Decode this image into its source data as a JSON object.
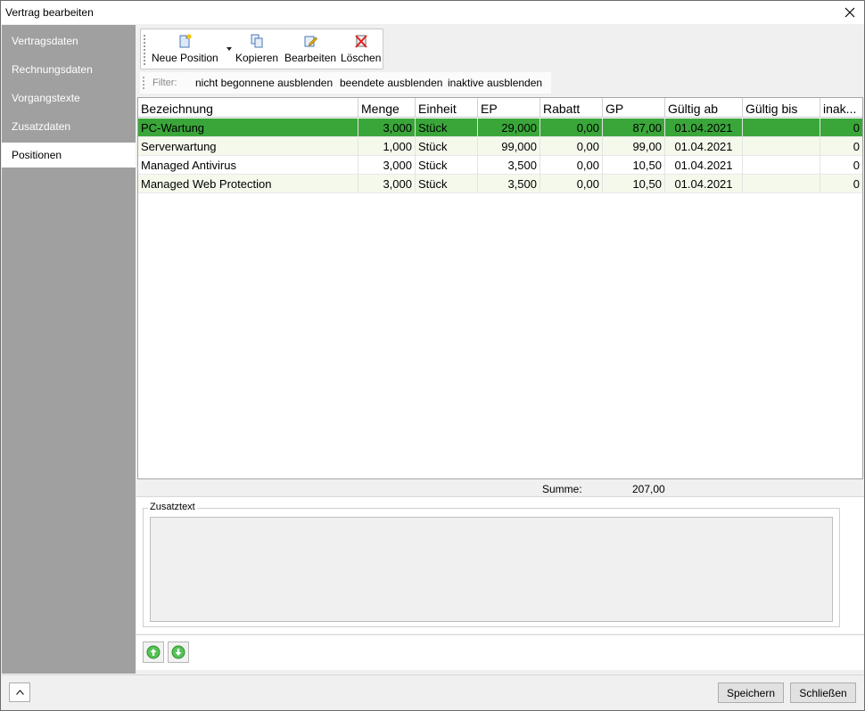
{
  "window": {
    "title": "Vertrag bearbeiten"
  },
  "sidebar": {
    "items": [
      {
        "label": "Vertragsdaten"
      },
      {
        "label": "Rechnungsdaten"
      },
      {
        "label": "Vorgangstexte"
      },
      {
        "label": "Zusatzdaten"
      },
      {
        "label": "Positionen",
        "active": true
      }
    ]
  },
  "toolbar": {
    "neue_position": "Neue Position",
    "kopieren": "Kopieren",
    "bearbeiten": "Bearbeiten",
    "loeschen": "Löschen"
  },
  "filter": {
    "label": "Filter:",
    "options": [
      "nicht begonnene ausblenden",
      "beendete ausblenden",
      "inaktive  ausblenden"
    ]
  },
  "grid": {
    "columns": [
      "Bezeichnung",
      "Menge",
      "Einheit",
      "EP",
      "Rabatt",
      "GP",
      "Gültig ab",
      "Gültig bis",
      "inak..."
    ],
    "rows": [
      [
        "PC-Wartung",
        "3,000",
        "Stück",
        "29,000",
        "0,00",
        "87,00",
        "01.04.2021",
        "",
        "0"
      ],
      [
        "Serverwartung",
        "1,000",
        "Stück",
        "99,000",
        "0,00",
        "99,00",
        "01.04.2021",
        "",
        "0"
      ],
      [
        "Managed Antivirus",
        "3,000",
        "Stück",
        "3,500",
        "0,00",
        "10,50",
        "01.04.2021",
        "",
        "0"
      ],
      [
        "Managed Web Protection",
        "3,000",
        "Stück",
        "3,500",
        "0,00",
        "10,50",
        "01.04.2021",
        "",
        "0"
      ]
    ],
    "selected_row": 0
  },
  "summary": {
    "label": "Summe:",
    "value": "207,00"
  },
  "zusatztext": {
    "legend": "Zusatztext",
    "value": ""
  },
  "footer": {
    "save": "Speichern",
    "close": "Schließen"
  },
  "colors": {
    "selection": "#3aa63a",
    "sidebar": "#a0a0a0",
    "alt_row": "#f5f9ec"
  }
}
